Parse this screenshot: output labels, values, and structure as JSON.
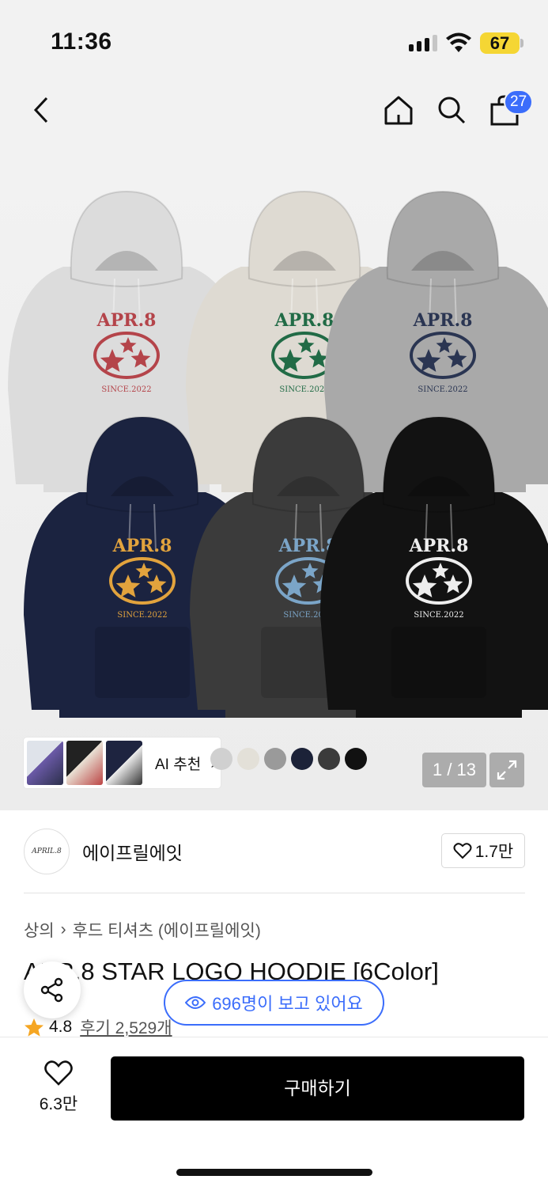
{
  "status_bar": {
    "time": "11:36",
    "battery": "67"
  },
  "nav": {
    "back_icon": "chevron-left-icon",
    "home_icon": "home-icon",
    "search_icon": "search-icon",
    "cart_icon": "shopping-bag-icon",
    "cart_count": "27"
  },
  "hero": {
    "ai_recommend_label": "AI 추천",
    "image_counter": "1 / 13",
    "swatch_colors": [
      "#d0d0d0",
      "#e3e0d8",
      "#9a9a9a",
      "#1c2238",
      "#3b3b3b",
      "#111111"
    ],
    "hoodies": [
      {
        "color": "#dcdcdc",
        "print": "#b4444a"
      },
      {
        "color": "#dedad2",
        "print": "#216b46"
      },
      {
        "color": "#a9a9a9",
        "print": "#2a3552"
      },
      {
        "color": "#1b2340",
        "print": "#e2a33d"
      },
      {
        "color": "#3b3b3b",
        "print": "#7ba5c8"
      },
      {
        "color": "#121212",
        "print": "#eeeeee"
      }
    ],
    "print_text": "APR.8",
    "print_subtext": "SINCE.2022"
  },
  "brand": {
    "name": "에이프릴에잇",
    "logo_text": "APRIL.8",
    "likes": "1.7만"
  },
  "product": {
    "category_1": "상의",
    "category_2": "후드 티셔츠 (에이프릴에잇)",
    "title": "APR.8 STAR LOGO HOODIE [6Color]",
    "rating": "4.8",
    "reviews": "후기 2,529개",
    "viewers": "696명이 보고 있어요"
  },
  "bottom_bar": {
    "favorites": "6.3만",
    "buy_label": "구매하기"
  }
}
